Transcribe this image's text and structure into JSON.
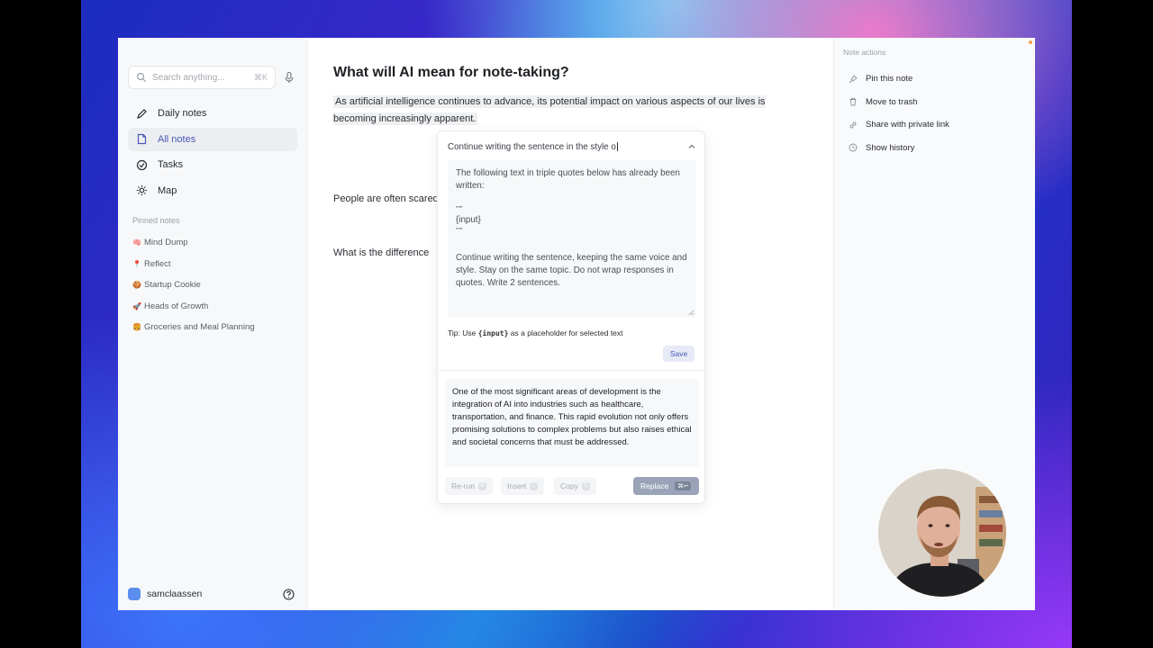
{
  "sidebar": {
    "search": {
      "placeholder": "Search anything...",
      "shortcut": "⌘K"
    },
    "nav": [
      {
        "label": "Daily notes",
        "icon": "pencil-icon"
      },
      {
        "label": "All notes",
        "icon": "note-icon",
        "active": true
      },
      {
        "label": "Tasks",
        "icon": "check-circle-icon"
      },
      {
        "label": "Map",
        "icon": "sun-icon"
      }
    ],
    "pinned_title": "Pinned notes",
    "pinned": [
      {
        "emoji": "🧠",
        "label": "Mind Dump"
      },
      {
        "emoji": "📍",
        "label": "Reflect"
      },
      {
        "emoji": "🍪",
        "label": "Startup Cookie"
      },
      {
        "emoji": "🚀",
        "label": "Heads of Growth"
      },
      {
        "emoji": "🍔",
        "label": "Groceries and Meal Planning"
      }
    ],
    "user": {
      "name": "samclaassen"
    }
  },
  "note": {
    "title": "What will AI mean for note-taking?",
    "paragraph": "As artificial intelligence continues to advance, its potential impact on various aspects of our lives is becoming increasingly apparent.",
    "line2": "People are often scared",
    "line3": "What is the difference"
  },
  "ai_popover": {
    "prompt_input": "Continue writing the sentence in the style o",
    "prompt_text_1": "The following text in triple quotes below has already been written:",
    "quote_open": "\"\"\"",
    "input_token": "{input}",
    "quote_close": "\"\"\"",
    "prompt_text_2": "Continue writing the sentence, keeping the same voice and style. Stay on the same topic. Do not wrap responses in quotes. Write 2 sentences.",
    "tip_prefix": "Tip: Use ",
    "tip_code": "{input}",
    "tip_suffix": " as a placeholder for selected text",
    "save_label": "Save",
    "result": "One of the most significant areas of development is the integration of AI into industries such as healthcare, transportation, and finance. This rapid evolution not only offers promising solutions to complex problems but also raises ethical and societal concerns that must be addressed.",
    "actions": {
      "rerun": "Re-run",
      "rerun_key": "R",
      "insert": "Insert",
      "insert_key": "I",
      "copy": "Copy",
      "copy_key": "C",
      "replace": "Replace",
      "replace_key": "⌘↩"
    }
  },
  "right_panel": {
    "title": "Note actions",
    "items": [
      {
        "label": "Pin this note",
        "icon": "pin-icon"
      },
      {
        "label": "Move to trash",
        "icon": "trash-icon"
      },
      {
        "label": "Share with private link",
        "icon": "link-icon"
      },
      {
        "label": "Show history",
        "icon": "clock-icon"
      }
    ]
  }
}
